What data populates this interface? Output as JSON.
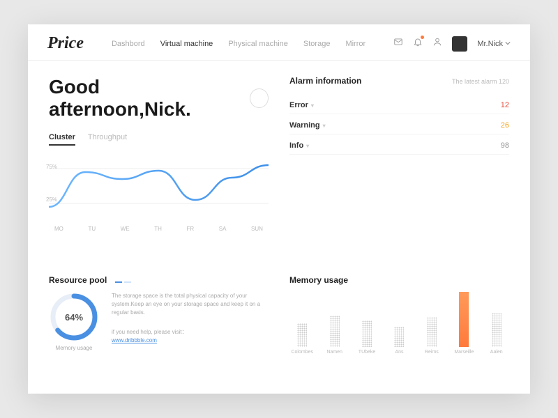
{
  "logo": "Price",
  "nav": {
    "items": [
      "Dashbord",
      "Virtual machine",
      "Physical machine",
      "Storage",
      "Mirror"
    ],
    "active_index": 1
  },
  "user": {
    "name": "Mr.Nick"
  },
  "greeting": "Good afternoon,Nick.",
  "cluster_tabs": {
    "items": [
      "Cluster",
      "Throughput"
    ],
    "active_index": 0
  },
  "alarm": {
    "title": "Alarm information",
    "subtitle": "The latest alarm 120",
    "rows": [
      {
        "label": "Error",
        "value": 12,
        "cls": "err"
      },
      {
        "label": "Warning",
        "value": 26,
        "cls": "warn"
      },
      {
        "label": "Info",
        "value": 98,
        "cls": "info"
      }
    ]
  },
  "resource": {
    "title": "Resource pool",
    "percent": 64,
    "percent_label": "64%",
    "donut_label": "Memory usage",
    "desc": "The storage space is the total physical capacity of your system.Keep an eye on your storage space and keep it on a regular basis.",
    "help_prefix": "if you need help, please visit：",
    "link_text": "www.dribbble.com"
  },
  "memory": {
    "title": "Memory usage"
  },
  "chart_data": [
    {
      "type": "line",
      "name": "cluster-throughput",
      "categories": [
        "MO",
        "TU",
        "WE",
        "TH",
        "FR",
        "SA",
        "SUN"
      ],
      "values": [
        20,
        70,
        60,
        72,
        30,
        62,
        80
      ],
      "ylim": [
        0,
        100
      ],
      "yticks": [
        25,
        75
      ],
      "ytick_labels": [
        "25%",
        "75%"
      ]
    },
    {
      "type": "bar",
      "name": "memory-usage",
      "categories": [
        "Colombes",
        "Namen",
        "TUbeke",
        "Ans",
        "Reims",
        "Marseille",
        "Aalen"
      ],
      "values": [
        38,
        50,
        42,
        32,
        48,
        88,
        55
      ],
      "ylim": [
        0,
        100
      ],
      "highlight_index": 5
    },
    {
      "type": "pie",
      "name": "resource-pool-donut",
      "series": [
        {
          "name": "Memory usage",
          "values": [
            64,
            36
          ]
        }
      ],
      "title": "Resource pool"
    }
  ]
}
